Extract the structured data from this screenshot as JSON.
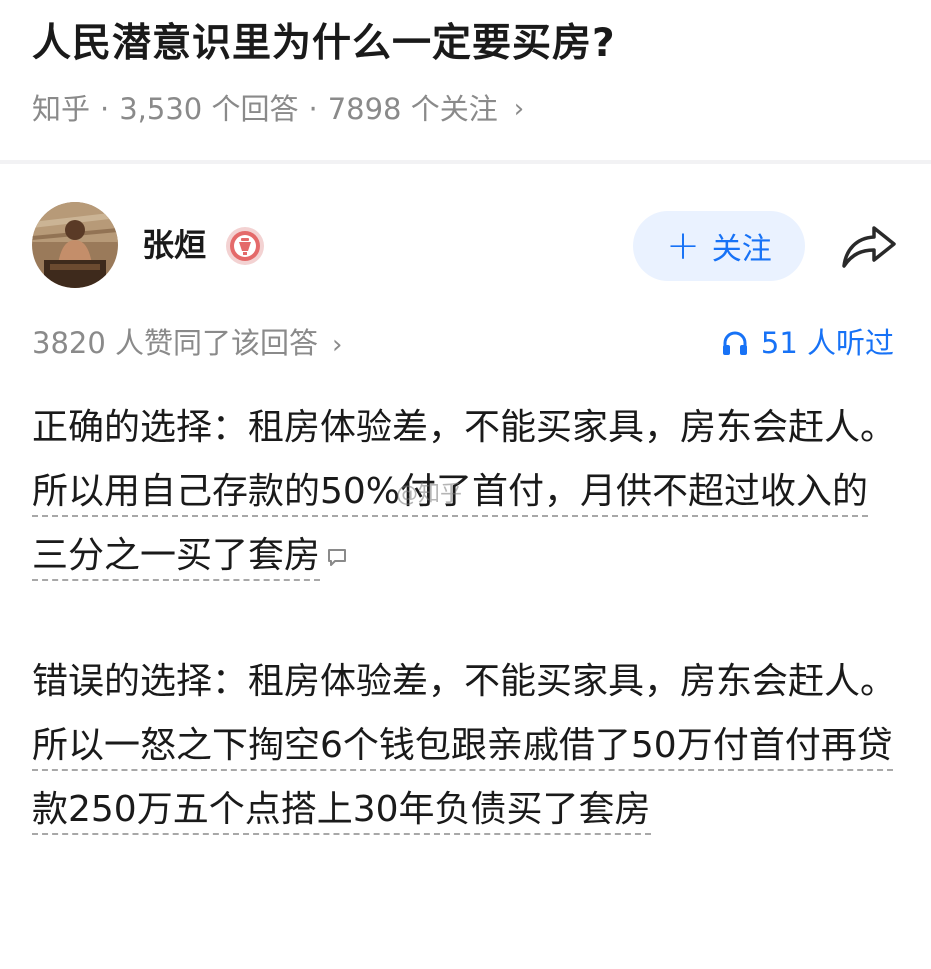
{
  "question": {
    "title": "人民潜意识里为什么一定要买房?",
    "meta": {
      "site": "知乎",
      "separator": "·",
      "answers": "3,530 个回答",
      "followers": "7898 个关注",
      "chevron": "›"
    }
  },
  "author": {
    "name": "张烜",
    "avatar_icon": "avatar-photo",
    "badge_icon": "creator-badge-icon",
    "follow_label": "关注",
    "follow_plus": "+",
    "share_icon": "share-arrow-icon"
  },
  "stats": {
    "likes": "3820 人赞同了该回答",
    "chevron": "›",
    "listen_icon": "headphones-icon",
    "listened": "51 人听过"
  },
  "answer": {
    "p1_prefix": "正确的选择：租房体验差，不能买家具，房东会赶人。",
    "p1_underlined": "所以用自己存款的50%付了首付，月供不超过收入的三分之一买了套房",
    "p2_prefix": "错误的选择：租房体验差，不能买家具，房东会赶人。",
    "p2_underlined": "所以一怒之下掏空6个钱包跟亲戚借了50万付首付再贷款250万五个点搭上30年负债买了套房",
    "comment_icon": "comment-bubble-icon"
  },
  "watermark": "@知乎"
}
